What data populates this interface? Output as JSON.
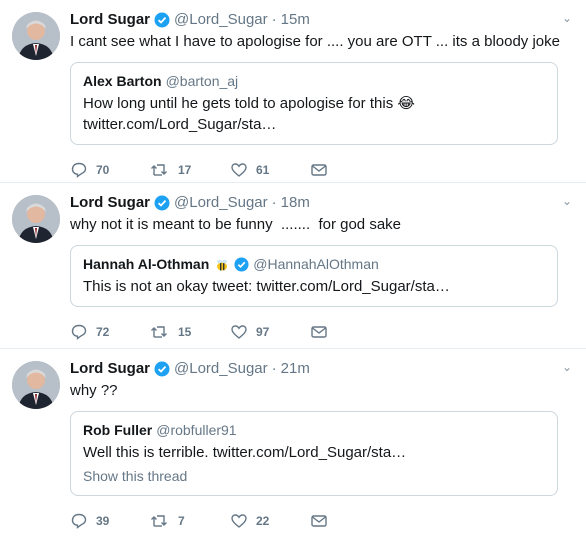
{
  "tweets": [
    {
      "author": "Lord Sugar",
      "handle": "@Lord_Sugar",
      "separator": "·",
      "time": "15m",
      "text": "I cant see what I have to apologise for .... you are OTT ... its a bloody joke",
      "quote": {
        "name": "Alex Barton",
        "handle": "@barton_aj",
        "text": "How long until he gets told to apologise for this 😂",
        "link": "twitter.com/Lord_Sugar/sta…"
      },
      "replies": "70",
      "retweets": "17",
      "likes": "61"
    },
    {
      "author": "Lord Sugar",
      "handle": "@Lord_Sugar",
      "separator": "·",
      "time": "18m",
      "text": "why not it is meant to be funny  .......  for god sake",
      "quote": {
        "name": "Hannah Al-Othman",
        "handle": "@HannahAlOthman",
        "text": "This is not an okay tweet: twitter.com/Lord_Sugar/sta…"
      },
      "replies": "72",
      "retweets": "15",
      "likes": "97"
    },
    {
      "author": "Lord Sugar",
      "handle": "@Lord_Sugar",
      "separator": "·",
      "time": "21m",
      "text": "why ??",
      "quote": {
        "name": "Rob Fuller",
        "handle": "@robfuller91",
        "text": "Well this is terrible. twitter.com/Lord_Sugar/sta…",
        "show_thread": "Show this thread"
      },
      "replies": "39",
      "retweets": "7",
      "likes": "22"
    }
  ],
  "colors": {
    "accent": "#1da1f2",
    "muted": "#657786",
    "border": "#e6ecf0"
  }
}
